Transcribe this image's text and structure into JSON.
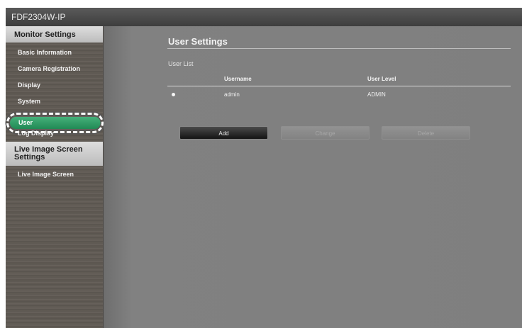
{
  "window": {
    "title": "FDF2304W-IP"
  },
  "sidebar": {
    "monitor_settings_header": "Monitor Settings",
    "items": [
      {
        "label": "Basic Information"
      },
      {
        "label": "Camera Registration"
      },
      {
        "label": "Display"
      },
      {
        "label": "System"
      },
      {
        "label": "User",
        "active": true
      },
      {
        "label": "Log Display"
      }
    ],
    "live_image_header": "Live Image Screen Settings",
    "live_items": [
      {
        "label": "Live Image Screen"
      }
    ],
    "active_color": "#2e9c63"
  },
  "main": {
    "title": "User Settings",
    "list_label": "User List",
    "table": {
      "columns": [
        "Username",
        "User Level"
      ],
      "rows": [
        {
          "username": "admin",
          "level": "ADMIN"
        }
      ]
    },
    "buttons": {
      "add": "Add",
      "change": "Change",
      "delete": "Delete"
    }
  }
}
